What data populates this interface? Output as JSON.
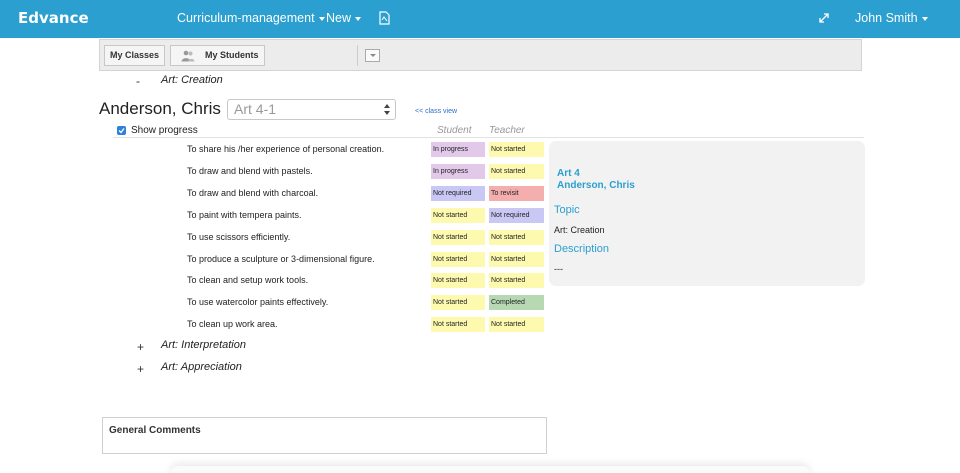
{
  "app": {
    "brand": "Edvance",
    "nav": {
      "curriculum_label": "Curriculum-management",
      "new_label": "New",
      "user_label": "John Smith"
    }
  },
  "toolbar": {
    "my_classes_label": "My Classes",
    "my_students_label": "My Students"
  },
  "topics": {
    "creation": {
      "sign": "-",
      "label": "Art: Creation"
    },
    "interpretation": {
      "sign": "+",
      "label": "Art: Interpretation"
    },
    "appreciation": {
      "sign": "+",
      "label": "Art: Appreciation"
    }
  },
  "student": {
    "name": "Anderson, Chris :",
    "class_selected": "Art 4-1",
    "class_view_link": "<< class view"
  },
  "progress": {
    "show_progress_label": "Show progress",
    "show_progress_checked": true,
    "student_col": "Student",
    "teacher_col": "Teacher",
    "rows": [
      {
        "goal": "To share his /her experience of personal creation.",
        "student": "In progress",
        "teacher": "Not started"
      },
      {
        "goal": "To draw and blend with pastels.",
        "student": "In progress",
        "teacher": "Not started"
      },
      {
        "goal": "To draw and blend with charcoal.",
        "student": "Not required",
        "teacher": "To revisit"
      },
      {
        "goal": "To paint with tempera paints.",
        "student": "Not started",
        "teacher": "Not required"
      },
      {
        "goal": "To use scissors efficiently.",
        "student": "Not started",
        "teacher": "Not started"
      },
      {
        "goal": "To produce a sculpture or 3-dimensional figure.",
        "student": "Not started",
        "teacher": "Not started"
      },
      {
        "goal": "To clean and setup work tools.",
        "student": "Not started",
        "teacher": "Not started"
      },
      {
        "goal": "To use watercolor paints effectively.",
        "student": "Not started",
        "teacher": "Completed"
      },
      {
        "goal": "To clean up work area.",
        "student": "Not started",
        "teacher": "Not started"
      }
    ],
    "status_colors": {
      "In progress": "#e2c9ea",
      "Not started": "#fdfab0",
      "Not required": "#c9c7f4",
      "To revisit": "#f4aeae",
      "Completed": "#b6d9b4"
    }
  },
  "info_panel": {
    "course": "Art 4",
    "student": "Anderson, Chris",
    "topic_heading": "Topic",
    "topic_value": "Art: Creation",
    "description_heading": "Description",
    "description_value": "---"
  },
  "comments": {
    "title": "General Comments"
  },
  "colors": {
    "accent": "#2a9fd0"
  }
}
